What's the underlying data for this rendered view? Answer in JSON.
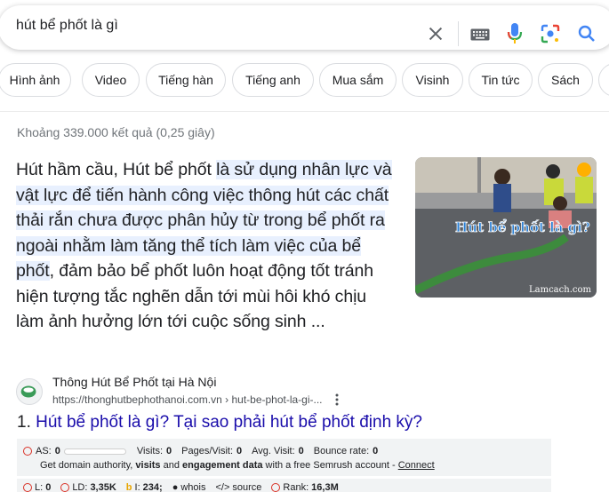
{
  "search": {
    "query": "hút bể phốt là gì"
  },
  "chips": [
    "Hình ảnh",
    "Video",
    "Tiếng hàn",
    "Tiếng anh",
    "Mua sắm",
    "Visinh",
    "Tin tức",
    "Sách"
  ],
  "result_stats": "Khoảng 339.000 kết quả (0,25 giây)",
  "snippet": {
    "part1": "Hút hầm cầu, Hút bể phốt ",
    "highlight": "là sử dụng nhân lực và vật lực để tiến hành công việc thông hút các chất thải rắn chưa được phân hủy từ trong bể phốt ra ngoài nhằm làm tăng thể tích làm việc của bể phốt",
    "part2": ", đảm bảo bể phốt luôn hoạt động tốt tránh hiện tượng tắc nghẽn dẫn tới mùi hôi khó chịu làm ảnh hưởng lớn tới cuộc sống sinh ...",
    "image_caption": "Hút bể phốt là gì?",
    "image_watermark": "Lamcach.com"
  },
  "source": {
    "site_name": "Thông Hút Bể Phốt tại Hà Nội",
    "url": "https://thonghutbephothanoi.com.vn › hut-be-phot-la-gi-..."
  },
  "result": {
    "number": "1.",
    "title": "Hút bể phốt là gì? Tại sao phải hút bể phốt định kỳ?"
  },
  "semrush": {
    "as_label": "AS:",
    "as_value": "0",
    "visits_label": "Visits:",
    "visits_value": "0",
    "pages_label": "Pages/Visit:",
    "pages_value": "0",
    "avg_label": "Avg. Visit:",
    "avg_value": "0",
    "bounce_label": "Bounce rate:",
    "bounce_value": "0",
    "promo_1": "Get domain authority,",
    "promo_2": "visits",
    "promo_3": " and ",
    "promo_4": "engagement data",
    "promo_5": " with a free Semrush account - ",
    "connect": "Connect",
    "l_label": "L:",
    "l_value": "0",
    "ld_label": "LD:",
    "ld_value": "3,35K",
    "i_label": "I:",
    "i_value": "234;",
    "whois": "whois",
    "source": "source",
    "rank_label": "Rank:",
    "rank_value": "16,3M"
  },
  "colors": {
    "link": "#1a0dab",
    "highlight": "#e8f0fe",
    "semrush_red": "#d93025"
  }
}
